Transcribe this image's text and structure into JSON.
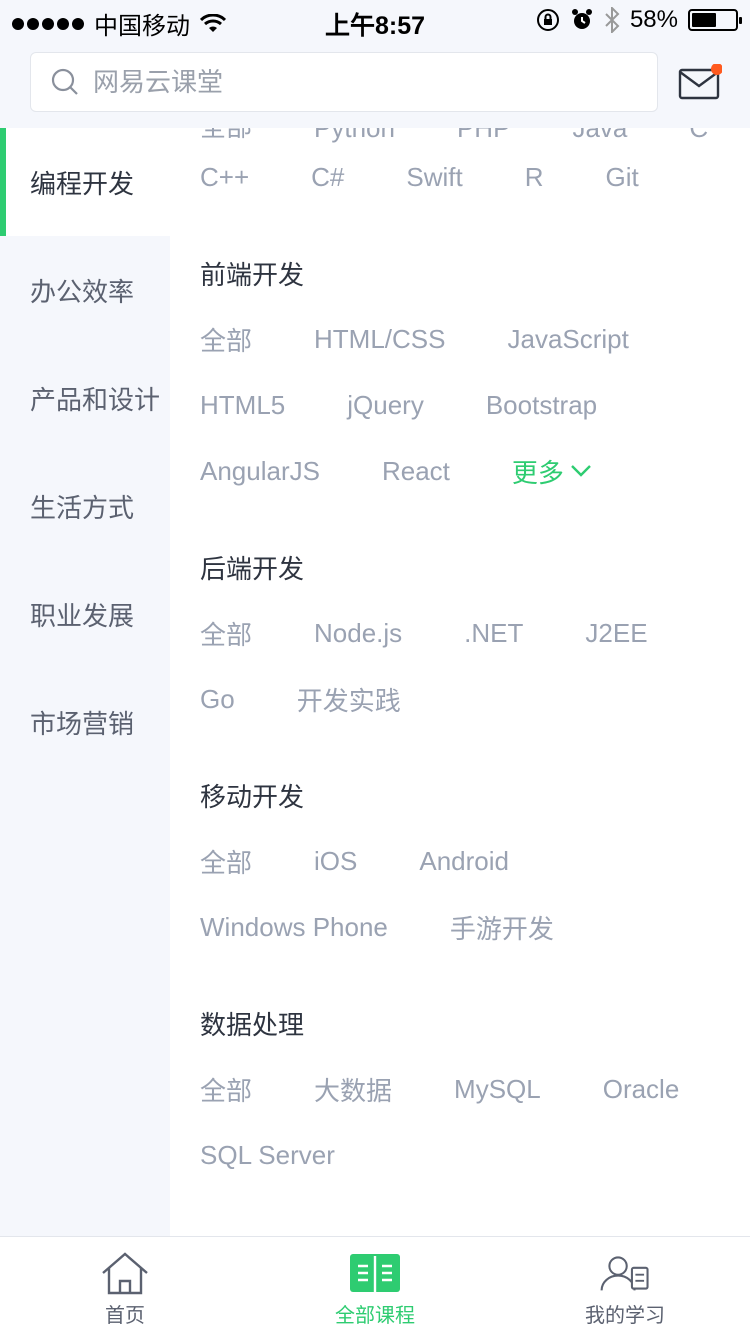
{
  "status_bar": {
    "carrier": "中国移动",
    "time": "上午8:57",
    "battery": "58%",
    "battery_level": 0.58
  },
  "search": {
    "placeholder": "网易云课堂"
  },
  "sidebar": {
    "items": [
      {
        "label": "编程开发",
        "active": true
      },
      {
        "label": "办公效率"
      },
      {
        "label": "产品和设计"
      },
      {
        "label": "生活方式"
      },
      {
        "label": "职业发展"
      },
      {
        "label": "市场营销"
      }
    ]
  },
  "content": {
    "top_partial_tags": [
      "全部",
      "Python",
      "PHP",
      "Java",
      "C"
    ],
    "top_tags": [
      "C++",
      "C#",
      "Swift",
      "R",
      "Git"
    ],
    "sections": [
      {
        "title": "前端开发",
        "rows": [
          [
            "全部",
            "HTML/CSS",
            "JavaScript"
          ],
          [
            "HTML5",
            "jQuery",
            "Bootstrap"
          ],
          [
            "AngularJS",
            "React"
          ]
        ],
        "more_label": "更多"
      },
      {
        "title": "后端开发",
        "rows": [
          [
            "全部",
            "Node.js",
            ".NET",
            "J2EE"
          ],
          [
            "Go",
            "开发实践"
          ]
        ]
      },
      {
        "title": "移动开发",
        "rows": [
          [
            "全部",
            "iOS",
            "Android"
          ],
          [
            "Windows Phone",
            "手游开发"
          ]
        ]
      },
      {
        "title": "数据处理",
        "rows": [
          [
            "全部",
            "大数据",
            "MySQL",
            "Oracle"
          ],
          [
            "SQL Server"
          ]
        ]
      }
    ]
  },
  "tabbar": {
    "home": "首页",
    "courses": "全部课程",
    "learning": "我的学习"
  },
  "colors": {
    "accent": "#2ecc71",
    "notification": "#ff5a1f",
    "tag": "#9aa2b2"
  }
}
